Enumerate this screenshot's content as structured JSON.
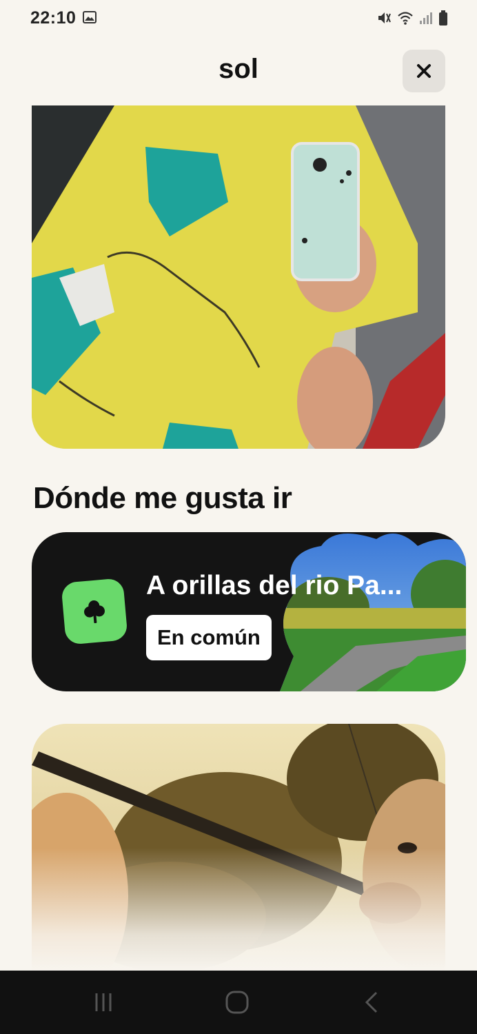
{
  "status_bar": {
    "time": "22:10",
    "icons": [
      "image-icon",
      "mute-icon",
      "wifi-icon",
      "signal-icon",
      "battery-icon"
    ]
  },
  "header": {
    "title": "sol",
    "close_icon": "close-icon"
  },
  "photos": [
    {
      "description_icon": "profile-photo",
      "alt": ""
    },
    {
      "description_icon": "profile-photo",
      "alt": ""
    }
  ],
  "places_section": {
    "heading": "Dónde me gusta ir",
    "card": {
      "title": "A orillas del rio Pa...",
      "badge": "En común",
      "icon": "tree-icon",
      "icon_color": "#69d96b"
    }
  },
  "nav_bar": {
    "buttons": [
      "recent-apps-icon",
      "home-icon",
      "back-icon"
    ]
  },
  "colors": {
    "background": "#f8f5ef",
    "card_dark": "#141414",
    "accent_green": "#69d96b"
  }
}
